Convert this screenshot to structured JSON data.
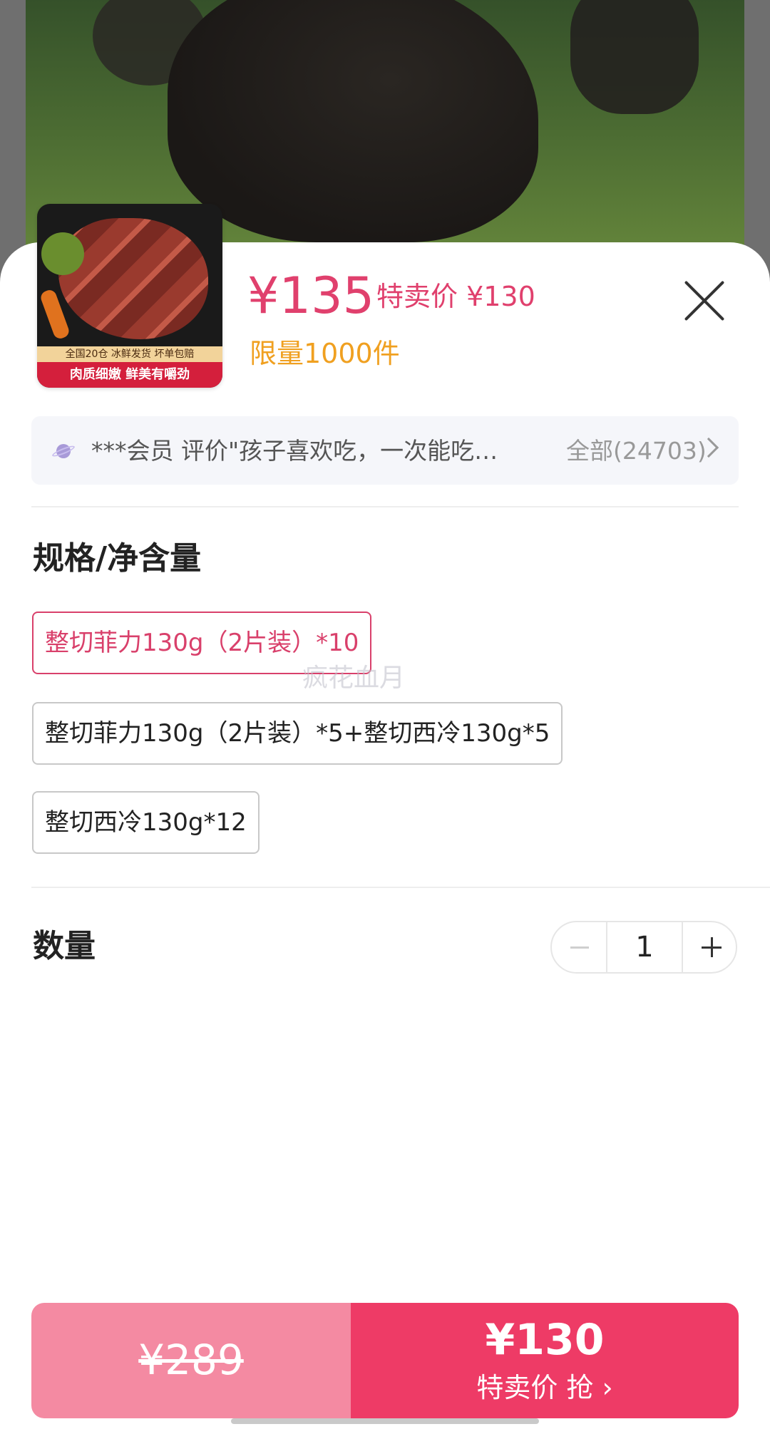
{
  "product": {
    "thumb_banner_top": "全国20仓 冰鲜发货 坏单包赔",
    "thumb_banner_bottom": "肉质细嫩 鲜美有嚼劲",
    "price": "¥135",
    "sale_price": "特卖价 ¥130",
    "limit": "限量1000件"
  },
  "review": {
    "text": "***会员 评价\"孩子喜欢吃，一次能吃…",
    "all": "全部(24703)"
  },
  "spec": {
    "title": "规格/净含量",
    "options": [
      {
        "label": "整切菲力130g（2片装）*10",
        "selected": true
      },
      {
        "label": "整切菲力130g（2片装）*5+整切西冷130g*5",
        "selected": false
      },
      {
        "label": "整切西冷130g*12",
        "selected": false
      }
    ]
  },
  "watermark": "疯花血月",
  "quantity": {
    "title": "数量",
    "value": "1"
  },
  "buy": {
    "original_price": "¥289",
    "now_price": "¥130",
    "cta": "特卖价 抢 ›"
  },
  "colors": {
    "accent": "#e0406d",
    "limit": "#f0a020",
    "buy_left": "#f48aa2",
    "buy_right": "#ee3b66"
  },
  "icons": [
    "close-icon",
    "planet-icon",
    "chevron-right-icon",
    "minus-icon",
    "plus-icon"
  ]
}
